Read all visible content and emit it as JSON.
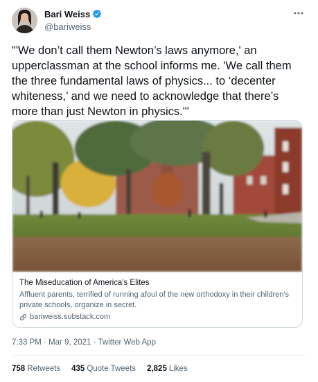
{
  "author": {
    "display_name": "Bari Weiss",
    "handle": "@bariweiss",
    "verified": true
  },
  "tweet": {
    "text": "\"'We don’t call them Newton’s laws anymore,' an upperclassman at the school informs me. 'We call them the three fundamental laws of physics... to ‘decenter whiteness,’ and we need to acknowledge that there’s more than just Newton in physics.'\""
  },
  "card": {
    "title": "The Miseducation of America's Elites",
    "description": "Affluent parents, terrified of running afoul of the new orthodoxy in their children's private schools, organize in secret.",
    "domain": "bariweiss.substack.com"
  },
  "meta": {
    "time": "7:33 PM",
    "separator": " · ",
    "date": "Mar 9, 2021",
    "source": "Twitter Web App"
  },
  "stats": {
    "retweets_count": "758",
    "retweets_label": "Retweets",
    "quotes_count": "435",
    "quotes_label": "Quote Tweets",
    "likes_count": "2,825",
    "likes_label": "Likes"
  },
  "colors": {
    "verified": "#1d9bf0",
    "secondary_text": "#536471",
    "border": "#cfd9de"
  },
  "icons": {
    "verified": "verified-badge-icon",
    "more": "more-icon",
    "link": "link-icon"
  }
}
